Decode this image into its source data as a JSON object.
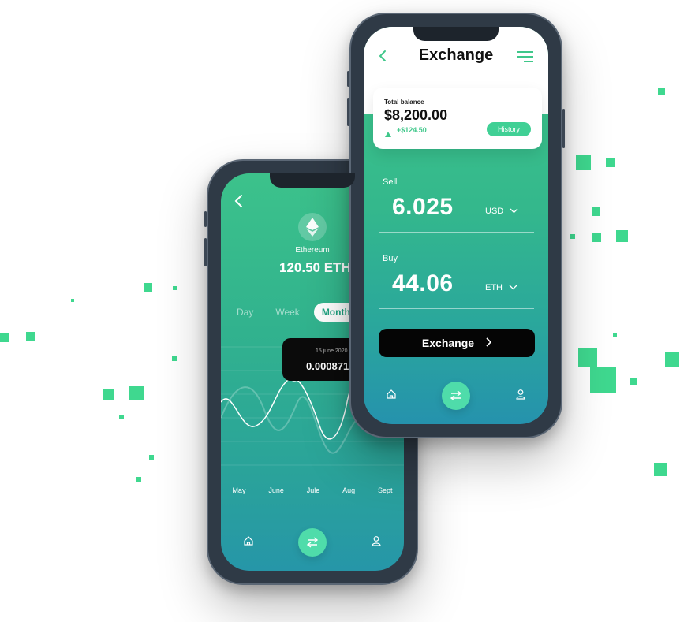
{
  "colors": {
    "accent": "#3fd88f",
    "gradient_top": "#3cc28b",
    "gradient_bottom": "#2592ad",
    "button": "#050505"
  },
  "asset_screen": {
    "back_icon": "chevron-left-icon",
    "coin_icon": "ethereum-icon",
    "coin_name": "Ethereum",
    "coin_amount": "120.50 ETH",
    "range_tabs": [
      {
        "label": "Day",
        "active": false
      },
      {
        "label": "Week",
        "active": false
      },
      {
        "label": "Month",
        "active": true
      }
    ],
    "tooltip": {
      "date": "15 june 2020",
      "value": "0.000871"
    },
    "months": [
      "May",
      "June",
      "Jule",
      "Aug",
      "Sept"
    ],
    "nav": [
      "home-icon",
      "exchange-icon",
      "user-icon"
    ]
  },
  "exchange_screen": {
    "back_icon": "chevron-left-icon",
    "title": "Exchange",
    "menu_icon": "menu-icon",
    "balance": {
      "label": "Total balance",
      "amount": "$8,200.00",
      "change": "+$124.50",
      "history_label": "History"
    },
    "sell": {
      "label": "Sell",
      "amount": "6.025",
      "currency": "USD"
    },
    "buy": {
      "label": "Buy",
      "amount": "44.06",
      "currency": "ETH"
    },
    "exchange_button": "Exchange",
    "nav": [
      "home-icon",
      "exchange-icon",
      "user-icon"
    ]
  }
}
